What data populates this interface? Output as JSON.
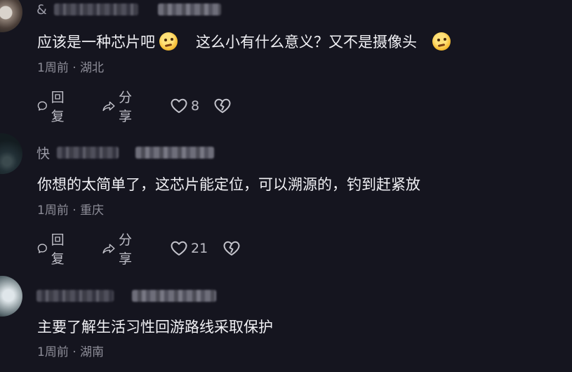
{
  "comments": [
    {
      "name_prefix": "&",
      "text_part1": "应该是一种芯片吧",
      "text_part2": "这么小有什么意义？又不是摄像头",
      "emoji": "🤔",
      "time": "1周前",
      "separator": "·",
      "location": "湖北",
      "reply_label": "回复",
      "share_label": "分享",
      "likes": "8"
    },
    {
      "name_prefix": "快",
      "text_part1": "你想的太简单了，这芯片能定位，可以溯源的，钓到赶紧放",
      "time": "1周前",
      "separator": "·",
      "location": "重庆",
      "reply_label": "回复",
      "share_label": "分享",
      "likes": "21"
    },
    {
      "name_prefix": "",
      "text_part1": "主要了解生活习性回游路线采取保护",
      "time": "1周前",
      "separator": "·",
      "location": "湖南"
    }
  ],
  "icons": {
    "reply": "comment-bubble-icon",
    "share": "share-arrow-icon",
    "like": "heart-outline-icon",
    "dislike": "broken-heart-icon"
  }
}
